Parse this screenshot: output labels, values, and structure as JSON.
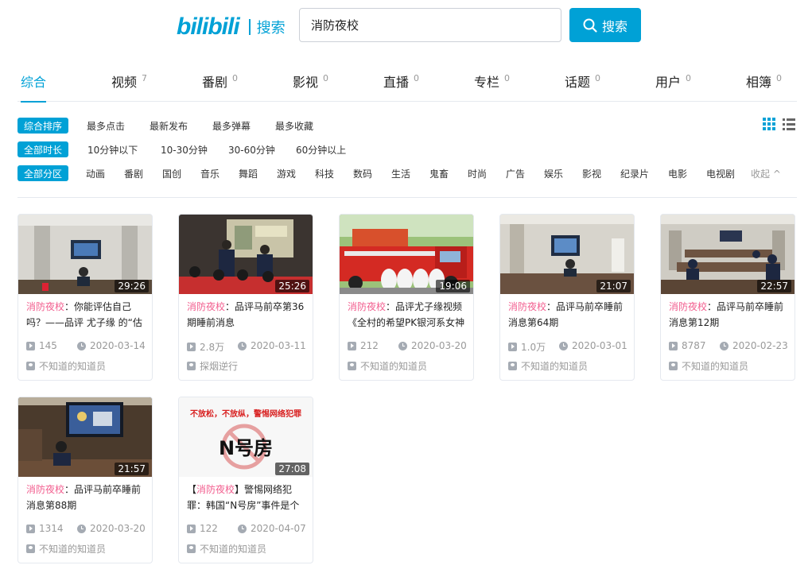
{
  "header": {
    "logo_text": "bilibili",
    "logo_subtitle": "搜索",
    "search_value": "消防夜校",
    "search_button": "搜索"
  },
  "tabs": [
    {
      "label": "综合",
      "count": ""
    },
    {
      "label": "视频",
      "count": "7"
    },
    {
      "label": "番剧",
      "count": "0"
    },
    {
      "label": "影视",
      "count": "0"
    },
    {
      "label": "直播",
      "count": "0"
    },
    {
      "label": "专栏",
      "count": "0"
    },
    {
      "label": "话题",
      "count": "0"
    },
    {
      "label": "用户",
      "count": "0"
    },
    {
      "label": "相簿",
      "count": "0"
    }
  ],
  "filters": {
    "sort": {
      "active": "综合排序",
      "options": [
        "最多点击",
        "最新发布",
        "最多弹幕",
        "最多收藏"
      ]
    },
    "duration": {
      "active": "全部时长",
      "options": [
        "10分钟以下",
        "10-30分钟",
        "30-60分钟",
        "60分钟以上"
      ]
    },
    "zone": {
      "active": "全部分区",
      "options": [
        "动画",
        "番剧",
        "国创",
        "音乐",
        "舞蹈",
        "游戏",
        "科技",
        "数码",
        "生活",
        "鬼畜",
        "时尚",
        "广告",
        "娱乐",
        "影视",
        "纪录片",
        "电影",
        "电视剧"
      ],
      "collapse": "收起"
    }
  },
  "videos": [
    {
      "duration": "29:26",
      "title_pre": "",
      "keyword": "消防夜校",
      "title_rest": "：你能评估自己吗？——品评 尤子缘 的“估",
      "views": "145",
      "date": "2020-03-14",
      "uploader": "不知道的知道员"
    },
    {
      "duration": "25:26",
      "title_pre": "",
      "keyword": "消防夜校",
      "title_rest": "：品评马前卒第36期睡前消息",
      "views": "2.8万",
      "date": "2020-03-11",
      "uploader": "探烟逆行"
    },
    {
      "duration": "19:06",
      "title_pre": "",
      "keyword": "消防夜校",
      "title_rest": "：品评尤子缘视频《全村的希望PK银河系女神",
      "views": "212",
      "date": "2020-03-20",
      "uploader": "不知道的知道员"
    },
    {
      "duration": "21:07",
      "title_pre": "",
      "keyword": "消防夜校",
      "title_rest": "：品评马前卒睡前消息第64期",
      "views": "1.0万",
      "date": "2020-03-01",
      "uploader": "不知道的知道员"
    },
    {
      "duration": "22:57",
      "title_pre": "",
      "keyword": "消防夜校",
      "title_rest": "：品评马前卒睡前消息第12期",
      "views": "8787",
      "date": "2020-02-23",
      "uploader": "不知道的知道员"
    },
    {
      "duration": "21:57",
      "title_pre": "",
      "keyword": "消防夜校",
      "title_rest": "：品评马前卒睡前消息第88期",
      "views": "1314",
      "date": "2020-03-20",
      "uploader": "不知道的知道员"
    },
    {
      "duration": "27:08",
      "title_pre": "【",
      "keyword": "消防夜校",
      "title_rest": "】警惕网络犯罪：韩国“N号房”事件是个",
      "views": "122",
      "date": "2020-04-07",
      "uploader": "不知道的知道员",
      "thumb_text_top": "不放松，不放纵，警惕网络犯罪",
      "thumb_text_main": "N号房"
    }
  ]
}
